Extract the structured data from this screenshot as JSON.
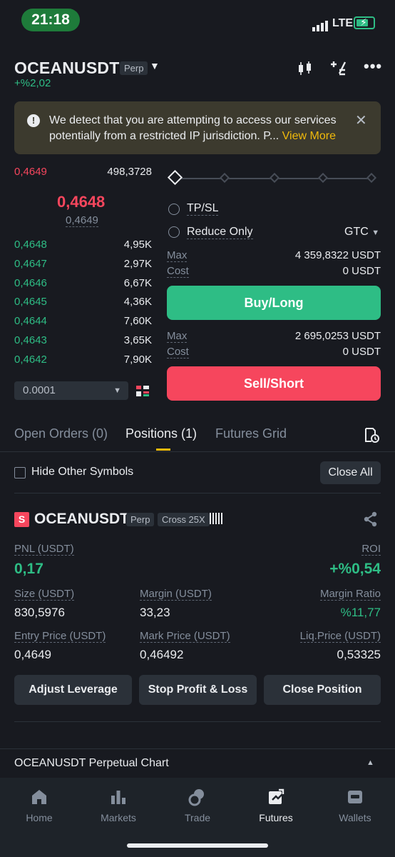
{
  "status_bar": {
    "time": "21:18",
    "network": "LTE"
  },
  "header": {
    "symbol": "OCEANUSDT",
    "contract_tag": "Perp",
    "change": "+%2,02"
  },
  "banner": {
    "text": "We detect that you are attempting to access our services potentially from a restricted IP jurisdiction. P...",
    "link": "View More"
  },
  "order_book": {
    "ask": {
      "price": "0,4649",
      "qty": "498,3728"
    },
    "last_price": "0,4648",
    "mark_price": "0,4649",
    "bids": [
      {
        "price": "0,4648",
        "qty": "4,95K"
      },
      {
        "price": "0,4647",
        "qty": "2,97K"
      },
      {
        "price": "0,4646",
        "qty": "6,67K"
      },
      {
        "price": "0,4645",
        "qty": "4,36K"
      },
      {
        "price": "0,4644",
        "qty": "7,60K"
      },
      {
        "price": "0,4643",
        "qty": "3,65K"
      },
      {
        "price": "0,4642",
        "qty": "7,90K"
      }
    ],
    "tick_size": "0.0001"
  },
  "order_form": {
    "tpsl_label": "TP/SL",
    "reduce_only_label": "Reduce Only",
    "time_in_force": "GTC",
    "buy": {
      "max_label": "Max",
      "max_value": "4 359,8322 USDT",
      "cost_label": "Cost",
      "cost_value": "0 USDT",
      "button": "Buy/Long"
    },
    "sell": {
      "max_label": "Max",
      "max_value": "2 695,0253 USDT",
      "cost_label": "Cost",
      "cost_value": "0 USDT",
      "button": "Sell/Short"
    }
  },
  "tabs": [
    "Open Orders (0)",
    "Positions (1)",
    "Futures Grid"
  ],
  "positions_toolbar": {
    "hide_label": "Hide Other Symbols",
    "close_all": "Close All"
  },
  "position": {
    "side_badge": "S",
    "symbol": "OCEANUSDT",
    "contract_tag": "Perp",
    "margin_tag": "Cross 25X",
    "pnl_label": "PNL (USDT)",
    "pnl_value": "0,17",
    "roi_label": "ROI",
    "roi_value": "+%0,54",
    "size_label": "Size (USDT)",
    "size_value": "830,5976",
    "margin_label": "Margin (USDT)",
    "margin_value": "33,23",
    "margin_ratio_label": "Margin Ratio",
    "margin_ratio_value": "%11,77",
    "entry_label": "Entry Price (USDT)",
    "entry_value": "0,4649",
    "mark_label": "Mark Price (USDT)",
    "mark_value": "0,46492",
    "liq_label": "Liq.Price (USDT)",
    "liq_value": "0,53325",
    "buttons": [
      "Adjust Leverage",
      "Stop Profit & Loss",
      "Close Position"
    ]
  },
  "chart_bar": {
    "label": "OCEANUSDT Perpetual  Chart"
  },
  "nav": [
    "Home",
    "Markets",
    "Trade",
    "Futures",
    "Wallets"
  ],
  "colors": {
    "buy": "#2EBD85",
    "sell": "#F6465D",
    "accent": "#F0B90B",
    "bg": "#181A20"
  }
}
